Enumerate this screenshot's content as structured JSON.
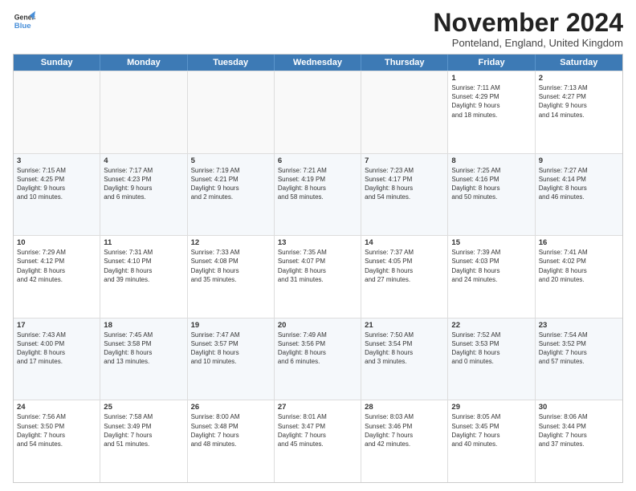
{
  "logo": {
    "line1": "General",
    "line2": "Blue"
  },
  "title": "November 2024",
  "location": "Ponteland, England, United Kingdom",
  "days_of_week": [
    "Sunday",
    "Monday",
    "Tuesday",
    "Wednesday",
    "Thursday",
    "Friday",
    "Saturday"
  ],
  "weeks": [
    [
      {
        "day": "",
        "info": "",
        "empty": true
      },
      {
        "day": "",
        "info": "",
        "empty": true
      },
      {
        "day": "",
        "info": "",
        "empty": true
      },
      {
        "day": "",
        "info": "",
        "empty": true
      },
      {
        "day": "",
        "info": "",
        "empty": true
      },
      {
        "day": "1",
        "info": "Sunrise: 7:11 AM\nSunset: 4:29 PM\nDaylight: 9 hours\nand 18 minutes.",
        "empty": false
      },
      {
        "day": "2",
        "info": "Sunrise: 7:13 AM\nSunset: 4:27 PM\nDaylight: 9 hours\nand 14 minutes.",
        "empty": false
      }
    ],
    [
      {
        "day": "3",
        "info": "Sunrise: 7:15 AM\nSunset: 4:25 PM\nDaylight: 9 hours\nand 10 minutes.",
        "empty": false
      },
      {
        "day": "4",
        "info": "Sunrise: 7:17 AM\nSunset: 4:23 PM\nDaylight: 9 hours\nand 6 minutes.",
        "empty": false
      },
      {
        "day": "5",
        "info": "Sunrise: 7:19 AM\nSunset: 4:21 PM\nDaylight: 9 hours\nand 2 minutes.",
        "empty": false
      },
      {
        "day": "6",
        "info": "Sunrise: 7:21 AM\nSunset: 4:19 PM\nDaylight: 8 hours\nand 58 minutes.",
        "empty": false
      },
      {
        "day": "7",
        "info": "Sunrise: 7:23 AM\nSunset: 4:17 PM\nDaylight: 8 hours\nand 54 minutes.",
        "empty": false
      },
      {
        "day": "8",
        "info": "Sunrise: 7:25 AM\nSunset: 4:16 PM\nDaylight: 8 hours\nand 50 minutes.",
        "empty": false
      },
      {
        "day": "9",
        "info": "Sunrise: 7:27 AM\nSunset: 4:14 PM\nDaylight: 8 hours\nand 46 minutes.",
        "empty": false
      }
    ],
    [
      {
        "day": "10",
        "info": "Sunrise: 7:29 AM\nSunset: 4:12 PM\nDaylight: 8 hours\nand 42 minutes.",
        "empty": false
      },
      {
        "day": "11",
        "info": "Sunrise: 7:31 AM\nSunset: 4:10 PM\nDaylight: 8 hours\nand 39 minutes.",
        "empty": false
      },
      {
        "day": "12",
        "info": "Sunrise: 7:33 AM\nSunset: 4:08 PM\nDaylight: 8 hours\nand 35 minutes.",
        "empty": false
      },
      {
        "day": "13",
        "info": "Sunrise: 7:35 AM\nSunset: 4:07 PM\nDaylight: 8 hours\nand 31 minutes.",
        "empty": false
      },
      {
        "day": "14",
        "info": "Sunrise: 7:37 AM\nSunset: 4:05 PM\nDaylight: 8 hours\nand 27 minutes.",
        "empty": false
      },
      {
        "day": "15",
        "info": "Sunrise: 7:39 AM\nSunset: 4:03 PM\nDaylight: 8 hours\nand 24 minutes.",
        "empty": false
      },
      {
        "day": "16",
        "info": "Sunrise: 7:41 AM\nSunset: 4:02 PM\nDaylight: 8 hours\nand 20 minutes.",
        "empty": false
      }
    ],
    [
      {
        "day": "17",
        "info": "Sunrise: 7:43 AM\nSunset: 4:00 PM\nDaylight: 8 hours\nand 17 minutes.",
        "empty": false
      },
      {
        "day": "18",
        "info": "Sunrise: 7:45 AM\nSunset: 3:58 PM\nDaylight: 8 hours\nand 13 minutes.",
        "empty": false
      },
      {
        "day": "19",
        "info": "Sunrise: 7:47 AM\nSunset: 3:57 PM\nDaylight: 8 hours\nand 10 minutes.",
        "empty": false
      },
      {
        "day": "20",
        "info": "Sunrise: 7:49 AM\nSunset: 3:56 PM\nDaylight: 8 hours\nand 6 minutes.",
        "empty": false
      },
      {
        "day": "21",
        "info": "Sunrise: 7:50 AM\nSunset: 3:54 PM\nDaylight: 8 hours\nand 3 minutes.",
        "empty": false
      },
      {
        "day": "22",
        "info": "Sunrise: 7:52 AM\nSunset: 3:53 PM\nDaylight: 8 hours\nand 0 minutes.",
        "empty": false
      },
      {
        "day": "23",
        "info": "Sunrise: 7:54 AM\nSunset: 3:52 PM\nDaylight: 7 hours\nand 57 minutes.",
        "empty": false
      }
    ],
    [
      {
        "day": "24",
        "info": "Sunrise: 7:56 AM\nSunset: 3:50 PM\nDaylight: 7 hours\nand 54 minutes.",
        "empty": false
      },
      {
        "day": "25",
        "info": "Sunrise: 7:58 AM\nSunset: 3:49 PM\nDaylight: 7 hours\nand 51 minutes.",
        "empty": false
      },
      {
        "day": "26",
        "info": "Sunrise: 8:00 AM\nSunset: 3:48 PM\nDaylight: 7 hours\nand 48 minutes.",
        "empty": false
      },
      {
        "day": "27",
        "info": "Sunrise: 8:01 AM\nSunset: 3:47 PM\nDaylight: 7 hours\nand 45 minutes.",
        "empty": false
      },
      {
        "day": "28",
        "info": "Sunrise: 8:03 AM\nSunset: 3:46 PM\nDaylight: 7 hours\nand 42 minutes.",
        "empty": false
      },
      {
        "day": "29",
        "info": "Sunrise: 8:05 AM\nSunset: 3:45 PM\nDaylight: 7 hours\nand 40 minutes.",
        "empty": false
      },
      {
        "day": "30",
        "info": "Sunrise: 8:06 AM\nSunset: 3:44 PM\nDaylight: 7 hours\nand 37 minutes.",
        "empty": false
      }
    ]
  ]
}
